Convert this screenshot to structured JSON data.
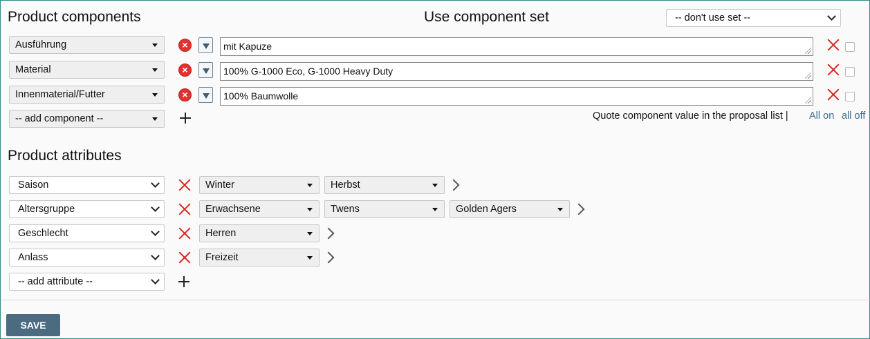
{
  "components": {
    "title": "Product components",
    "set_title": "Use component set",
    "set_select": "-- don't use set --",
    "rows": [
      {
        "name": "Ausführung",
        "value": "mit Kapuze"
      },
      {
        "name": "Material",
        "value": "100% G-1000 Eco, G-1000 Heavy Duty"
      },
      {
        "name": "Innenmaterial/Futter",
        "value": "100% Baumwolle"
      }
    ],
    "add_select": "-- add component --",
    "quote_text": "Quote component value in the proposal list |",
    "all_on": "All on",
    "all_off": "all off"
  },
  "attributes": {
    "title": "Product attributes",
    "rows": [
      {
        "name": "Saison",
        "values": [
          "Winter",
          "Herbst"
        ]
      },
      {
        "name": "Altersgruppe",
        "values": [
          "Erwachsene",
          "Twens",
          "Golden Agers"
        ]
      },
      {
        "name": "Geschlecht",
        "values": [
          "Herren"
        ]
      },
      {
        "name": "Anlass",
        "values": [
          "Freizeit"
        ]
      }
    ],
    "add_select": "-- add attribute --"
  },
  "save_label": "SAVE",
  "colors": {
    "frame_border": "#2e8b84",
    "delete_red": "#d9241f",
    "save_bg": "#4a6b80",
    "link": "#3c6a8f"
  }
}
